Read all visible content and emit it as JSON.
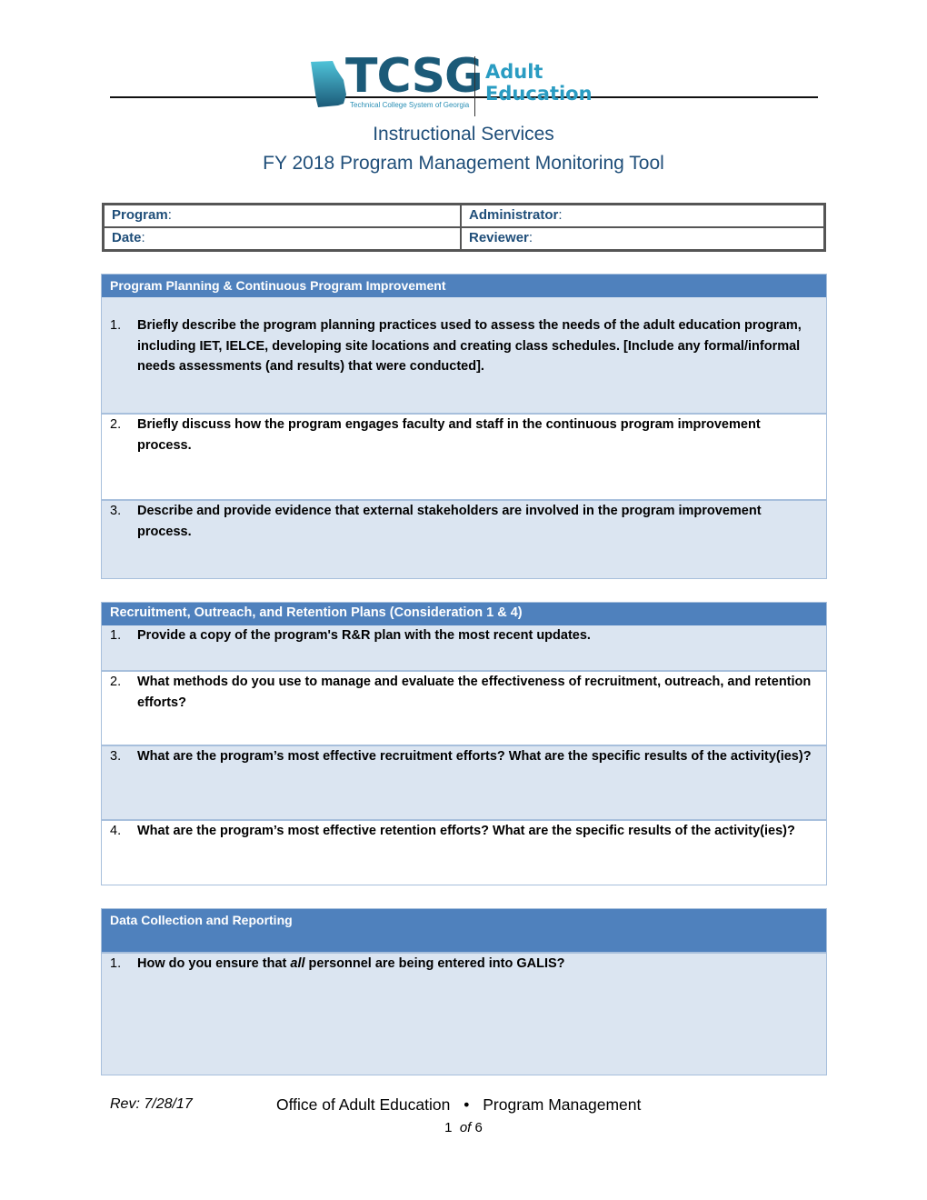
{
  "header": {
    "logo": {
      "acronym": "TCSG",
      "subtitle": "Technical College System of Georgia",
      "division_line1": "Adult",
      "division_line2": "Education",
      "icon": "georgia-state-map-icon",
      "colors": {
        "dark": "#1b5a78",
        "light": "#2a9cc2"
      }
    },
    "title": "Instructional Services",
    "subtitle": "FY 2018 Program Management Monitoring Tool"
  },
  "info_table": {
    "program_label": "Program",
    "program_value": "",
    "administrator_label": "Administrator",
    "administrator_value": "",
    "date_label": "Date",
    "date_value": "",
    "reviewer_label": "Reviewer",
    "reviewer_value": ""
  },
  "sections": [
    {
      "title": "Program Planning & Continuous Program Improvement",
      "questions": [
        {
          "number": "1.",
          "text": "Briefly describe the program planning practices used to assess the needs of the adult education program, including IET, IELCE, developing site locations and creating class schedules. [Include any formal/informal needs assessments (and results) that were conducted]."
        },
        {
          "number": "2.",
          "text": "Briefly discuss how the program engages faculty and staff in the continuous program improvement process."
        },
        {
          "number": "3.",
          "text": "Describe and provide evidence that external stakeholders are involved in the program improvement process."
        }
      ]
    },
    {
      "title": "Recruitment, Outreach, and Retention Plans (Consideration 1 & 4)",
      "questions": [
        {
          "number": "1.",
          "text": "Provide a copy of the program's R&R plan with the most recent updates."
        },
        {
          "number": "2.",
          "text": "What methods do you use to manage and evaluate the effectiveness of recruitment, outreach, and retention efforts?"
        },
        {
          "number": "3.",
          "text": "What are the program’s most effective recruitment efforts? What are the specific results of the activity(ies)?"
        },
        {
          "number": "4.",
          "text": "What are the program’s most effective retention efforts? What are the specific results of the activity(ies)?"
        }
      ]
    },
    {
      "title": "Data Collection and Reporting",
      "questions": [
        {
          "number": "1.",
          "text_before": "How do you ensure that ",
          "text_emph": "all",
          "text_after": " personnel are being entered into GALIS?"
        }
      ]
    }
  ],
  "footer": {
    "revision": "Rev: 7/28/17",
    "office": "Office of Adult Education",
    "separator": "•",
    "department": "Program Management",
    "page_current": "1",
    "page_of": "of",
    "page_total": "6"
  },
  "colors": {
    "section_header_bg": "#4f81bd",
    "shaded_row_bg": "#dbe5f1",
    "label_blue": "#1f4e79",
    "border_blue": "#a7bfdc"
  }
}
